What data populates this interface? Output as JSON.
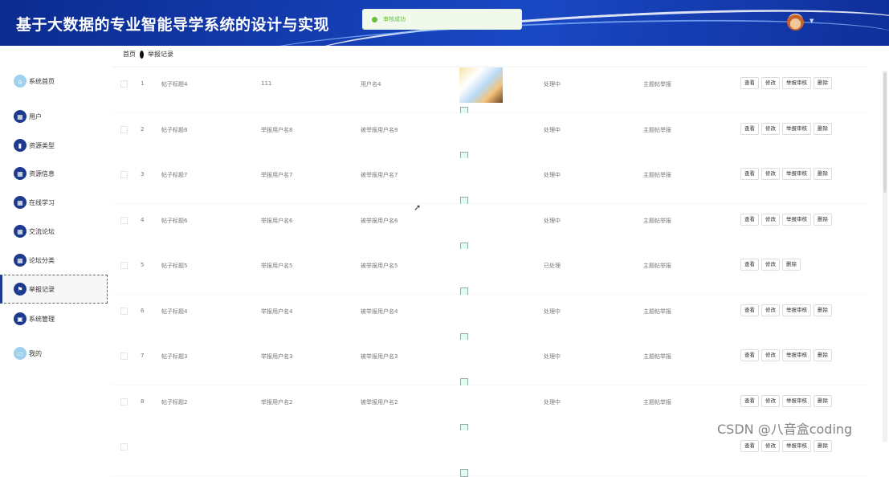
{
  "header": {
    "title": "基于大数据的专业智能导学系统的设计与实现",
    "toast_message": "审核成功"
  },
  "sidebar": {
    "items": [
      {
        "label": "系统首页",
        "icon": "home-icon"
      },
      {
        "label": "用户",
        "icon": "grid-icon"
      },
      {
        "label": "资源类型",
        "icon": "folder-icon"
      },
      {
        "label": "资源信息",
        "icon": "grid-icon"
      },
      {
        "label": "在线学习",
        "icon": "grid-icon"
      },
      {
        "label": "交流论坛",
        "icon": "grid-icon"
      },
      {
        "label": "论坛分类",
        "icon": "grid-icon"
      },
      {
        "label": "举报记录",
        "icon": "flag-icon"
      },
      {
        "label": "系统管理",
        "icon": "settings-icon"
      },
      {
        "label": "我的",
        "icon": "user-icon"
      }
    ],
    "active_label": "举报记录"
  },
  "breadcrumb": {
    "home": "首页",
    "current": "举报记录"
  },
  "table": {
    "rows": [
      {
        "index": "1",
        "post_title": "帖子标题4",
        "reporter": "111",
        "reported": "用户名4",
        "status": "处理中",
        "type": "主题帖举报",
        "actions": [
          "查看",
          "修改",
          "举报审核",
          "删除"
        ],
        "has_thumbnail": true
      },
      {
        "index": "2",
        "post_title": "帖子标题8",
        "reporter": "举报用户名8",
        "reported": "被举报用户名8",
        "status": "处理中",
        "type": "主题帖举报",
        "actions": [
          "查看",
          "修改",
          "举报审核",
          "删除"
        ],
        "has_thumbnail": false
      },
      {
        "index": "3",
        "post_title": "帖子标题7",
        "reporter": "举报用户名7",
        "reported": "被举报用户名7",
        "status": "处理中",
        "type": "主题帖举报",
        "actions": [
          "查看",
          "修改",
          "举报审核",
          "删除"
        ],
        "has_thumbnail": false
      },
      {
        "index": "4",
        "post_title": "帖子标题6",
        "reporter": "举报用户名6",
        "reported": "被举报用户名6",
        "status": "处理中",
        "type": "主题帖举报",
        "actions": [
          "查看",
          "修改",
          "举报审核",
          "删除"
        ],
        "has_thumbnail": false
      },
      {
        "index": "5",
        "post_title": "帖子标题5",
        "reporter": "举报用户名5",
        "reported": "被举报用户名5",
        "status": "已处理",
        "type": "主题帖举报",
        "actions": [
          "查看",
          "修改",
          "删除"
        ],
        "has_thumbnail": false
      },
      {
        "index": "6",
        "post_title": "帖子标题4",
        "reporter": "举报用户名4",
        "reported": "被举报用户名4",
        "status": "处理中",
        "type": "主题帖举报",
        "actions": [
          "查看",
          "修改",
          "举报审核",
          "删除"
        ],
        "has_thumbnail": false
      },
      {
        "index": "7",
        "post_title": "帖子标题3",
        "reporter": "举报用户名3",
        "reported": "被举报用户名3",
        "status": "处理中",
        "type": "主题帖举报",
        "actions": [
          "查看",
          "修改",
          "举报审核",
          "删除"
        ],
        "has_thumbnail": false
      },
      {
        "index": "8",
        "post_title": "帖子标题2",
        "reporter": "举报用户名2",
        "reported": "被举报用户名2",
        "status": "处理中",
        "type": "主题帖举报",
        "actions": [
          "查看",
          "修改",
          "举报审核",
          "删除"
        ],
        "has_thumbnail": false
      },
      {
        "index": "",
        "post_title": "",
        "reporter": "",
        "reported": "",
        "status": "",
        "type": "",
        "actions": [
          "查看",
          "修改",
          "举报审核",
          "删除"
        ],
        "has_thumbnail": false
      }
    ]
  },
  "watermark": "CSDN @八音盒coding",
  "colors": {
    "header_blue": "#1641b8",
    "nav_icon": "#1c3b8f",
    "success_green": "#67c23a"
  }
}
